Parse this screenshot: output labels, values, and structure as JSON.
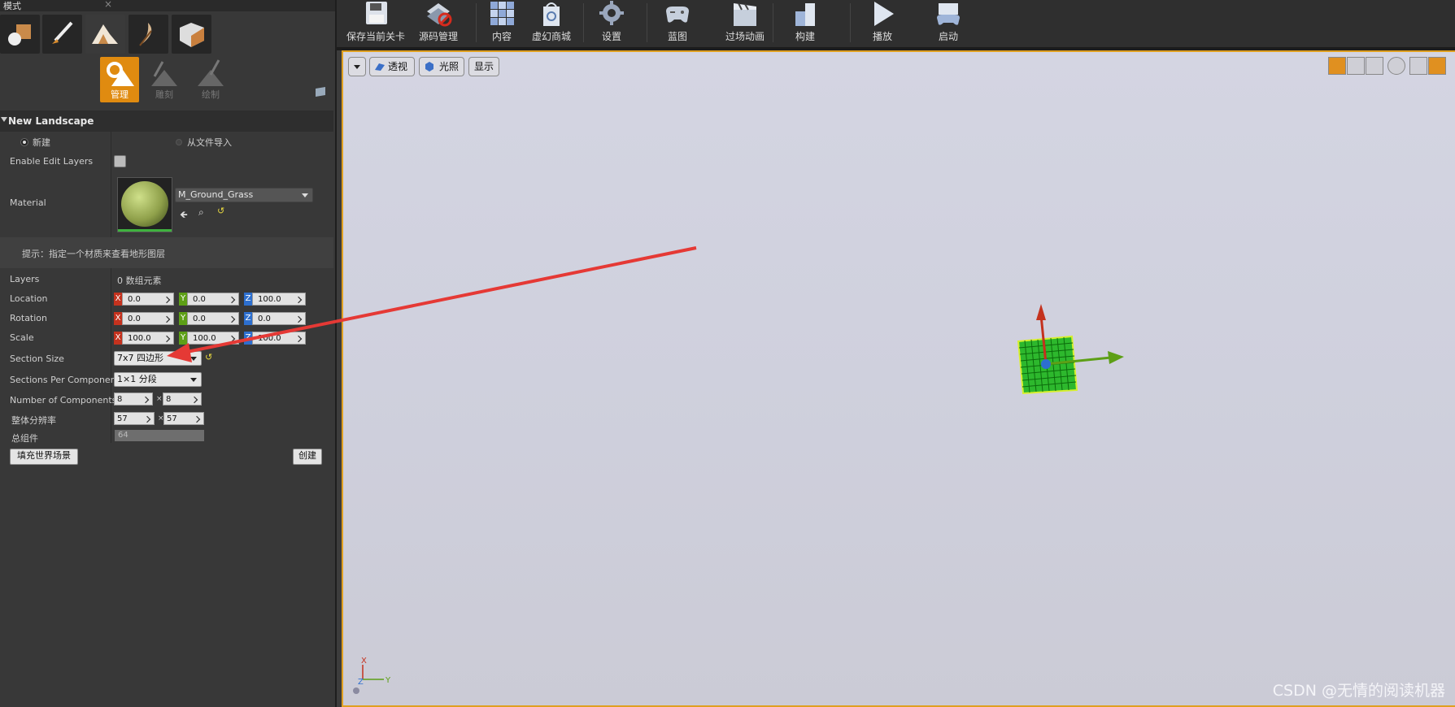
{
  "panel": {
    "tab_title": "模式",
    "close": "×",
    "tools": [
      "管理",
      "雕刻",
      "绘制"
    ]
  },
  "section": {
    "title": "New Landscape"
  },
  "radios": {
    "new": "新建",
    "import": "从文件导入"
  },
  "props": {
    "edit_layers": "Enable Edit Layers",
    "material": "Material",
    "material_value": "M_Ground_Grass",
    "hint": "提示：指定一个材质来查看地形图层",
    "layers": "Layers",
    "layers_value": "0 数组元素",
    "location": "Location",
    "rotation": "Rotation",
    "scale": "Scale",
    "section_size": "Section Size",
    "section_size_value": "7x7 四边形",
    "sections_per_component": "Sections Per Component",
    "sections_per_component_value": "1×1 分段",
    "number_of_components": "Number of Components",
    "resolution": "整体分辨率",
    "total_components": "总组件"
  },
  "values": {
    "loc": [
      "0.0",
      "0.0",
      "100.0"
    ],
    "rot": [
      "0.0",
      "0.0",
      "0.0"
    ],
    "scale": [
      "100.0",
      "100.0",
      "100.0"
    ],
    "components": [
      "8",
      "8"
    ],
    "resolution": [
      "57",
      "57"
    ],
    "total": "64"
  },
  "axis_letters": [
    "X",
    "Y",
    "Z"
  ],
  "times": "×",
  "buttons": {
    "fill_world": "填充世界场景",
    "create": "创建"
  },
  "toolbar": [
    "保存当前关卡",
    "源码管理",
    "内容",
    "虚幻商城",
    "设置",
    "蓝图",
    "过场动画",
    "构建",
    "播放",
    "启动"
  ],
  "viewport": {
    "perspective": "透视",
    "lit": "光照",
    "show": "显示"
  },
  "watermark": "CSDN @无情的阅读机器",
  "colors": {
    "accent": "#e08b10",
    "arrow": "#e53935",
    "gizmo_x": "#c4321e",
    "gizmo_y": "#5d9f16",
    "gizmo_z": "#2d6fcf"
  }
}
